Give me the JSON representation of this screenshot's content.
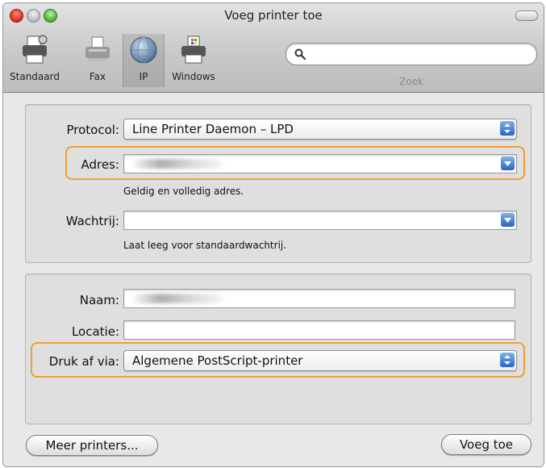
{
  "window": {
    "title": "Voeg printer toe"
  },
  "toolbar": {
    "items": [
      {
        "label": "Standaard",
        "icon": "printer-standard-icon"
      },
      {
        "label": "Fax",
        "icon": "fax-icon"
      },
      {
        "label": "IP",
        "icon": "ip-globe-icon",
        "selected": true
      },
      {
        "label": "Windows",
        "icon": "windows-printer-icon"
      }
    ],
    "search": {
      "label": "Zoek",
      "value": ""
    }
  },
  "connection": {
    "protocol_label": "Protocol:",
    "protocol_value": "Line Printer Daemon – LPD",
    "address_label": "Adres:",
    "address_hint": "Geldig en volledig adres.",
    "queue_label": "Wachtrij:",
    "queue_value": "",
    "queue_hint": "Laat leeg voor standaardwachtrij."
  },
  "details": {
    "name_label": "Naam:",
    "location_label": "Locatie:",
    "location_value": "",
    "print_via_label": "Druk af via:",
    "print_via_value": "Algemene PostScript-printer"
  },
  "buttons": {
    "more_printers": "Meer printers...",
    "add": "Voeg toe"
  },
  "colors": {
    "highlight": "#f0a030",
    "stepper": "#2764c7"
  }
}
